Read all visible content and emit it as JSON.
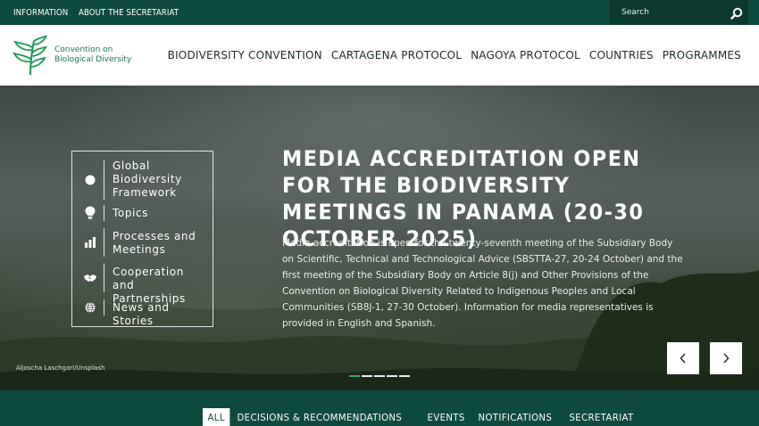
{
  "topbar": {
    "links": [
      "INFORMATION",
      "ABOUT THE SECRETARIAT"
    ],
    "search_placeholder": "Search"
  },
  "logo": {
    "line1": "Convention on",
    "line2": "Biological Diversity"
  },
  "mainnav": [
    "BIODIVERSITY CONVENTION",
    "CARTAGENA PROTOCOL",
    "NAGOYA PROTOCOL",
    "COUNTRIES",
    "PROGRAMMES"
  ],
  "hero": {
    "quicknav": [
      {
        "label": "Global Biodiversity Framework",
        "icon": "circle-icon"
      },
      {
        "label": "Topics",
        "icon": "lightbulb-icon"
      },
      {
        "label": "Processes and Meetings",
        "icon": "bar-chart-icon"
      },
      {
        "label": "Cooperation and Partnerships",
        "icon": "handshake-icon"
      },
      {
        "label": "News and Stories",
        "icon": "globe-icon"
      }
    ],
    "headline": "MEDIA ACCREDITATION OPEN FOR THE BIODIVERSITY MEETINGS IN PANAMA (20-30 OCTOBER 2025)",
    "summary": "Media accreditation is open for the twenty-seventh meeting of the Subsidiary Body on Scientific, Technical and Technological Advice (SBSTTA-27, 20-24 October) and the first meeting of the Subsidiary Body on Article 8(j) and Other Provisions of the Convention on Biological Diversity Related to Indigenous Peoples and Local Communities (SB8J-1, 27-30 October). Information for media representatives is provided in English and Spanish.",
    "credit": "Aljoscha Laschgari/Unsplash",
    "slide_count": 5,
    "active_slide": 1
  },
  "tabs": [
    {
      "label": "ALL",
      "active": true,
      "color": ""
    },
    {
      "label": "DECISIONS & RECOMMENDATIONS",
      "active": false,
      "color": "#e07b39"
    },
    {
      "label": "EVENTS",
      "active": false,
      "color": "#3aa3c4"
    },
    {
      "label": "NOTIFICATIONS",
      "active": false,
      "color": "#7b6cc4"
    },
    {
      "label": "SECRETARIAT",
      "active": false,
      "color": "#3aa86b"
    }
  ],
  "colors": {
    "brand_dark": "#0f4a3e",
    "logo_green": "#1a7a4c",
    "accent": "#3aa86b"
  }
}
